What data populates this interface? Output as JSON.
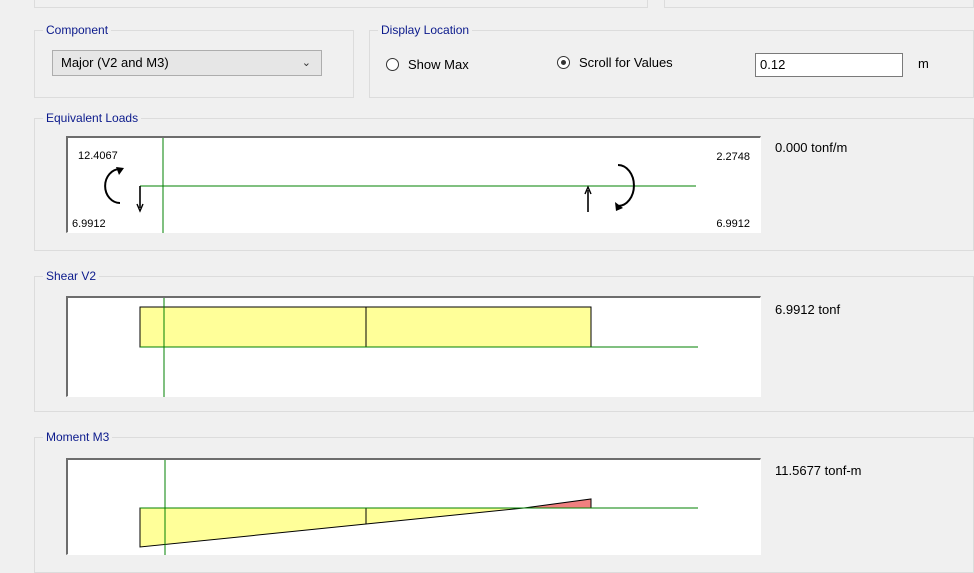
{
  "component": {
    "legend": "Component",
    "selected": "Major (V2 and M3)"
  },
  "display_location": {
    "legend": "Display Location",
    "options": [
      {
        "label": "Show Max",
        "selected": false
      },
      {
        "label": "Scroll for Values",
        "selected": true
      }
    ],
    "value": "0.12",
    "unit": "m"
  },
  "equivalent_loads": {
    "legend": "Equivalent Loads",
    "top_left": "12.4067",
    "bottom_left": "6.9912",
    "top_right": "2.2748",
    "bottom_right": "6.9912",
    "value": "0.000 tonf/m"
  },
  "shear": {
    "legend": "Shear V2",
    "value": "6.9912 tonf"
  },
  "moment": {
    "legend": "Moment M3",
    "value": "11.5677 tonf-m"
  },
  "colors": {
    "axis": "#008000",
    "positive_fill": "#ffff99",
    "negative_fill": "#f08080",
    "legend_text": "#0b1a8c"
  }
}
